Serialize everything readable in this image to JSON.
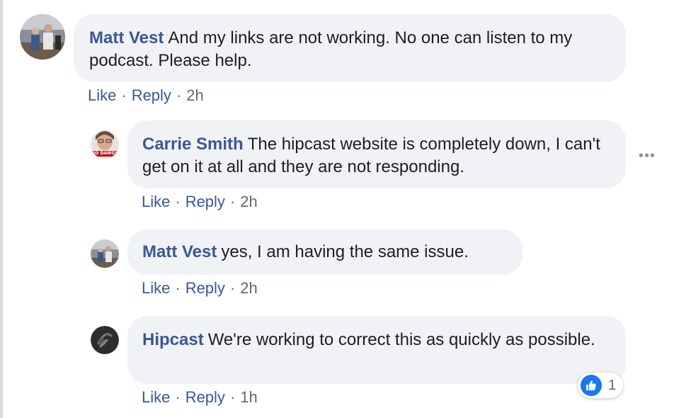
{
  "comments": [
    {
      "author": "Matt Vest",
      "text": "And my links are not working. No one can listen to my podcast. Please help.",
      "actions": {
        "like": "Like",
        "reply": "Reply",
        "time": "2h"
      }
    },
    {
      "author": "Carrie Smith",
      "text": "The hipcast website is completely down, I can't get on it at all and they are not responding.",
      "avatar_caption": "GO DAWGS",
      "actions": {
        "like": "Like",
        "reply": "Reply",
        "time": "2h"
      }
    },
    {
      "author": "Matt Vest",
      "text": "yes, I am having the same issue.",
      "actions": {
        "like": "Like",
        "reply": "Reply",
        "time": "2h"
      }
    },
    {
      "author": "Hipcast",
      "text": "We're working to correct this as quickly as possible.",
      "actions": {
        "like": "Like",
        "reply": "Reply",
        "time": "1h"
      },
      "reactions": {
        "icon": "like-thumb-icon",
        "count": "1",
        "color": "#1877f2"
      }
    }
  ],
  "more_options": {
    "icon": "more-horizontal-icon",
    "glyph": "•••"
  },
  "colors": {
    "link": "#385898",
    "bubble": "#f0f2f5",
    "meta": "#65676b"
  }
}
